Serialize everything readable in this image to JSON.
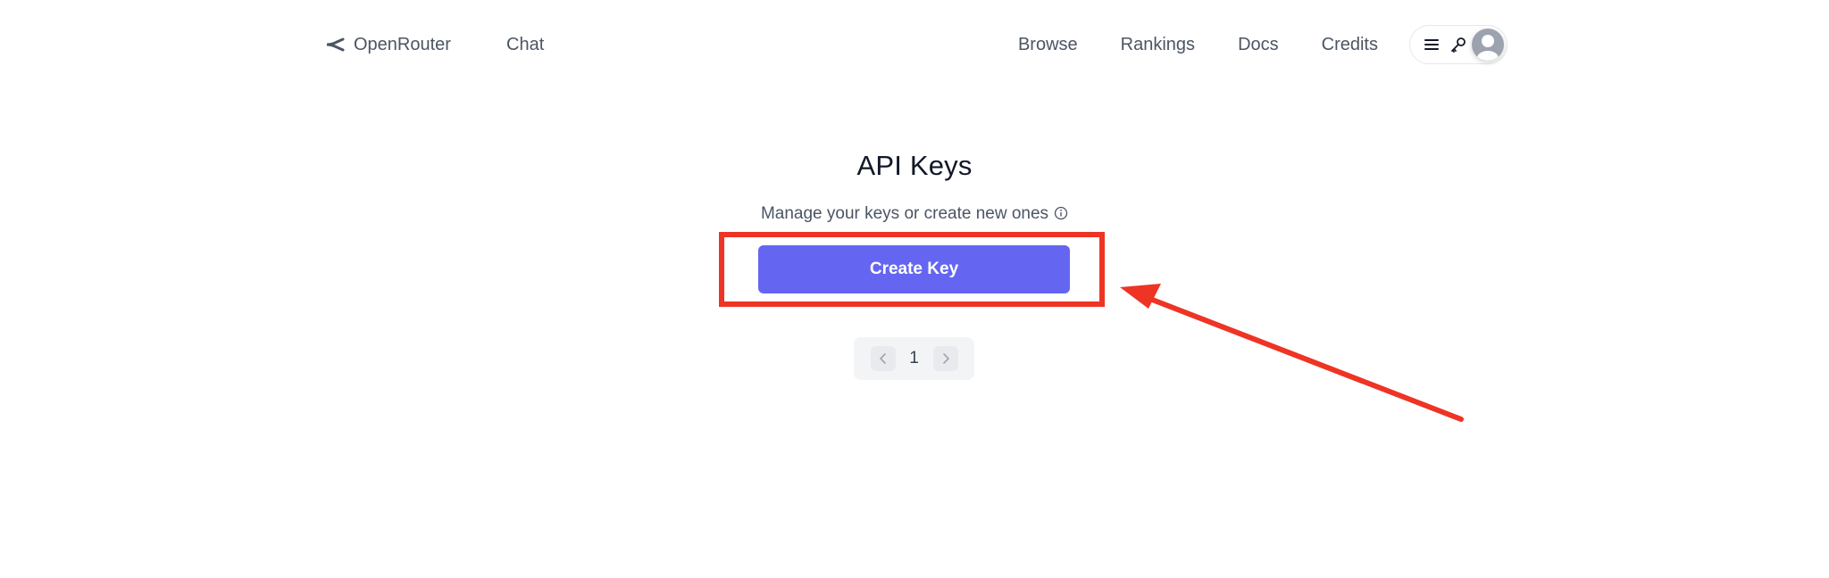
{
  "header": {
    "brand": "OpenRouter",
    "chat": "Chat",
    "nav": [
      "Browse",
      "Rankings",
      "Docs",
      "Credits"
    ]
  },
  "icons": {
    "brand": "openrouter-logo-icon",
    "menu": "hamburger-menu-icon",
    "key": "key-icon",
    "avatar": "user-avatar-icon",
    "info": "info-circle-icon",
    "prev": "chevron-left-icon",
    "next": "chevron-right-icon"
  },
  "main": {
    "title": "API Keys",
    "subtitle": "Manage your keys or create new ones",
    "create_button": "Create Key"
  },
  "pagination": {
    "current_page": "1"
  },
  "colors": {
    "primary": "#6466f1",
    "annotation": "#ee3424",
    "text_muted": "#4b5563"
  }
}
